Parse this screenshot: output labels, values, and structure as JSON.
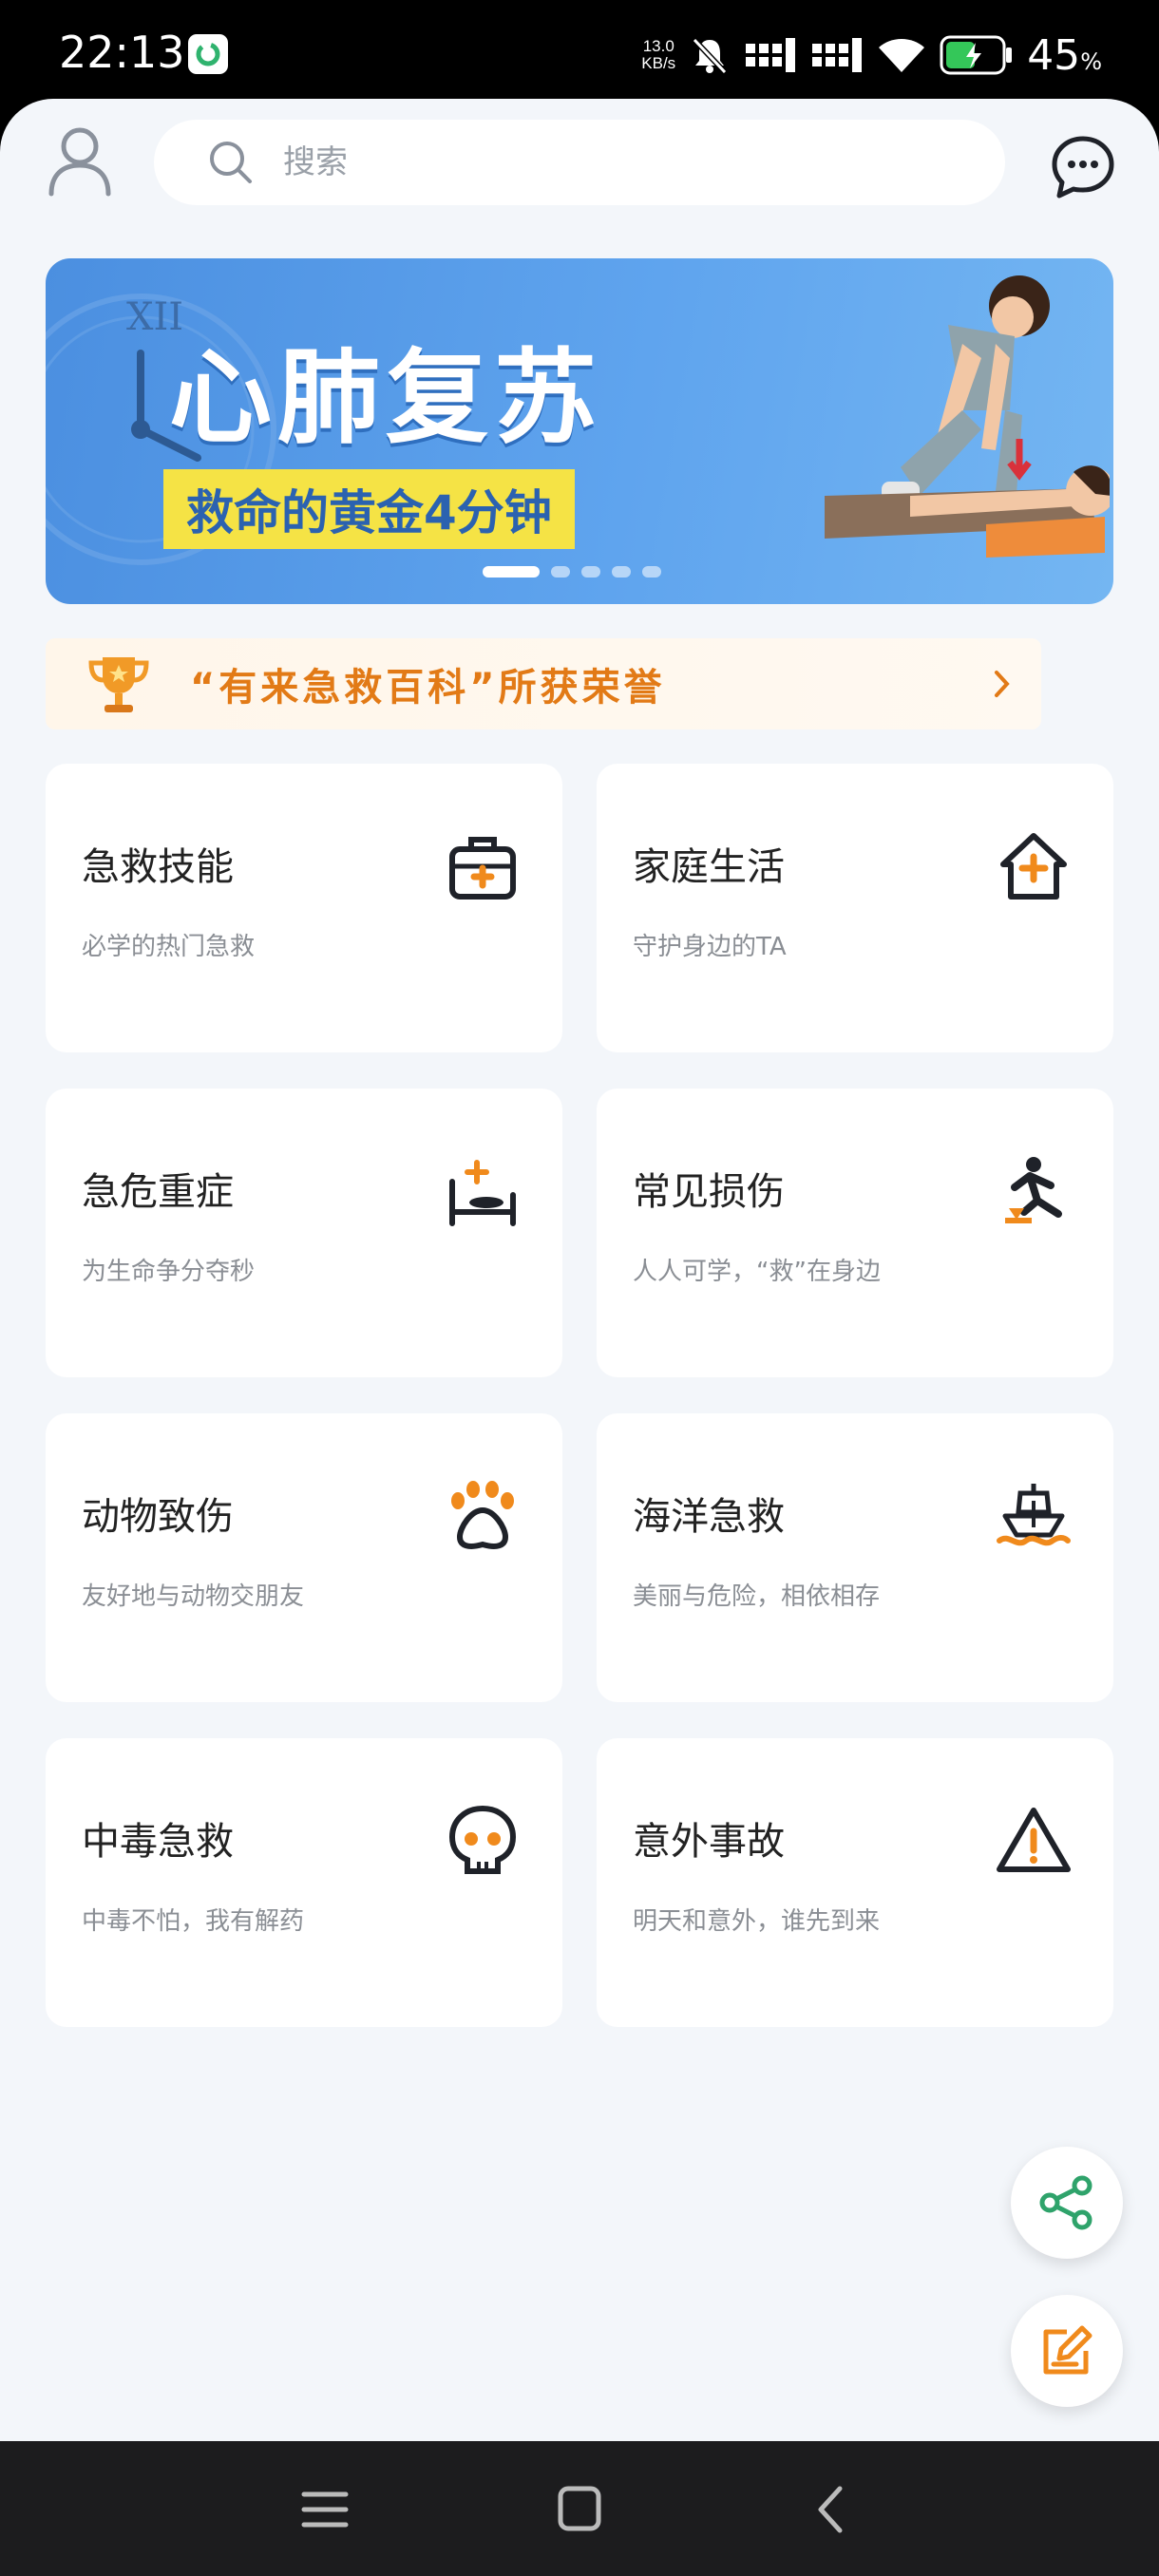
{
  "status_bar": {
    "time": "22:13",
    "net_speed_value": "13.0",
    "net_speed_unit": "KB/s",
    "battery_percent": "45",
    "battery_symbol": "%"
  },
  "header": {
    "search_placeholder": "搜索"
  },
  "banner": {
    "title": "心肺复苏",
    "subtitle": "救命的黄金4分钟",
    "slide_count": 5,
    "active_slide": 1
  },
  "honor": {
    "text": "“有来急救百科”所获荣誉"
  },
  "categories": [
    {
      "title": "急救技能",
      "subtitle": "必学的热门急救",
      "icon": "first-aid-kit-icon"
    },
    {
      "title": "家庭生活",
      "subtitle": "守护身边的TA",
      "icon": "home-plus-icon"
    },
    {
      "title": "急危重症",
      "subtitle": "为生命争分夺秒",
      "icon": "hospital-bed-icon"
    },
    {
      "title": "常见损伤",
      "subtitle": "人人可学，“救”在身边",
      "icon": "falling-person-icon"
    },
    {
      "title": "动物致伤",
      "subtitle": "友好地与动物交朋友",
      "icon": "paw-icon"
    },
    {
      "title": "海洋急救",
      "subtitle": "美丽与危险，相依相存",
      "icon": "ship-icon"
    },
    {
      "title": "中毒急救",
      "subtitle": "中毒不怕，我有解药",
      "icon": "skull-icon"
    },
    {
      "title": "意外事故",
      "subtitle": "明天和意外，谁先到来",
      "icon": "warning-icon"
    }
  ],
  "colors": {
    "accent_orange": "#f08a1c",
    "icon_dark": "#1f2229",
    "share_green": "#2fa36b",
    "page_bg": "#f3f6fa"
  }
}
